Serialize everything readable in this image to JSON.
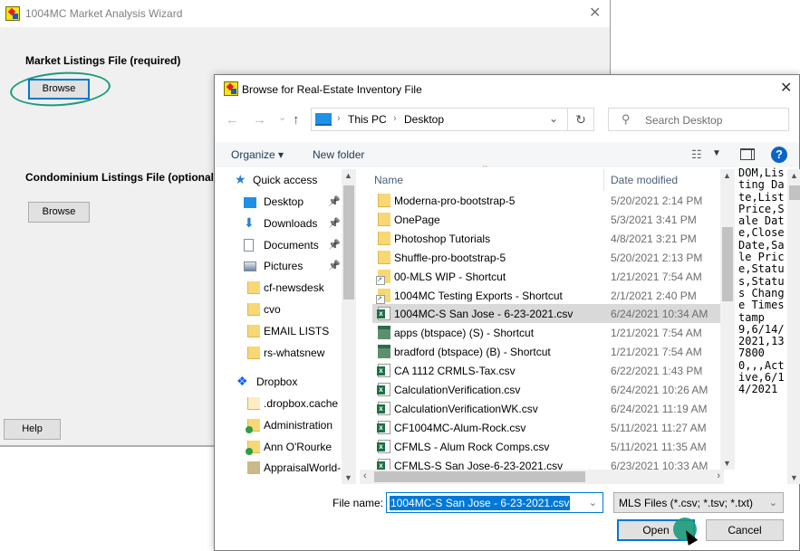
{
  "wizard": {
    "title": "1004MC Market Analysis Wizard",
    "market_label": "Market Listings File (required)",
    "market_browse": "Browse",
    "condo_label": "Condominium Listings File (optional)",
    "condo_browse": "Browse",
    "help": "Help",
    "close": "✕"
  },
  "dialog": {
    "title": "Browse for Real-Estate Inventory File",
    "close": "✕",
    "nav": {
      "back": "←",
      "forward": "→",
      "recent": "⌄",
      "up": "↑"
    },
    "breadcrumb": [
      "This PC",
      "Desktop"
    ],
    "breadcrumb_sep": "›",
    "refresh": "↻",
    "search_placeholder": "Search Desktop",
    "toolbar": {
      "organize": "Organize ▾",
      "new_folder": "New folder"
    },
    "nav_pane": [
      {
        "label": "Quick access",
        "icon": "star-icon"
      },
      {
        "label": "Desktop",
        "icon": "desktop-icon",
        "pinned": true
      },
      {
        "label": "Downloads",
        "icon": "download-icon",
        "pinned": true
      },
      {
        "label": "Documents",
        "icon": "document-icon",
        "pinned": true
      },
      {
        "label": "Pictures",
        "icon": "pictures-icon",
        "pinned": true
      },
      {
        "label": "cf-newsdesk",
        "icon": "folder-icon"
      },
      {
        "label": "cvo",
        "icon": "folder-icon"
      },
      {
        "label": "EMAIL LISTS",
        "icon": "folder-icon"
      },
      {
        "label": "rs-whatsnew",
        "icon": "folder-icon"
      },
      {
        "label": "Dropbox",
        "icon": "dropbox-icon"
      },
      {
        "label": ".dropbox.cache",
        "icon": "folder-icon"
      },
      {
        "label": "Administration",
        "icon": "folder-icon"
      },
      {
        "label": "Ann O'Rourke",
        "icon": "folder-icon"
      },
      {
        "label": "AppraisalWorld-",
        "icon": "shared-folder-icon"
      }
    ],
    "columns": {
      "name": "Name",
      "date": "Date modified"
    },
    "files": [
      {
        "name": "Moderna-pro-bootstrap-5",
        "date": "5/20/2021 2:14 PM",
        "type": "folder"
      },
      {
        "name": "OnePage",
        "date": "5/3/2021 3:41 PM",
        "type": "folder"
      },
      {
        "name": "Photoshop Tutorials",
        "date": "4/8/2021 3:21 PM",
        "type": "folder"
      },
      {
        "name": "Shuffle-pro-bootstrap-5",
        "date": "5/20/2021 2:13 PM",
        "type": "folder"
      },
      {
        "name": "00-MLS WIP - Shortcut",
        "date": "1/21/2021 7:54 AM",
        "type": "shortcut"
      },
      {
        "name": "1004MC Testing Exports - Shortcut",
        "date": "2/1/2021 2:40 PM",
        "type": "shortcut"
      },
      {
        "name": "1004MC-S San Jose - 6-23-2021.csv",
        "date": "6/24/2021 10:34 AM",
        "type": "csv",
        "selected": true
      },
      {
        "name": "apps (btspace) (S) - Shortcut",
        "date": "1/21/2021 7:54 AM",
        "type": "network"
      },
      {
        "name": "bradford (btspace) (B) - Shortcut",
        "date": "1/21/2021 7:54 AM",
        "type": "network"
      },
      {
        "name": "CA 1112 CRMLS-Tax.csv",
        "date": "6/22/2021 1:43 PM",
        "type": "csv"
      },
      {
        "name": "CalculationVerification.csv",
        "date": "6/24/2021 10:26 AM",
        "type": "csv"
      },
      {
        "name": "CalculationVerificationWK.csv",
        "date": "6/24/2021 11:19 AM",
        "type": "csv"
      },
      {
        "name": "CF1004MC-Alum-Rock.csv",
        "date": "5/11/2021 11:27 AM",
        "type": "csv"
      },
      {
        "name": "CFMLS - Alum Rock Comps.csv",
        "date": "5/11/2021 11:35 AM",
        "type": "csv"
      },
      {
        "name": "CFMLS-S San Jose-6-23-2021.csv",
        "date": "6/23/2021 10:33 AM",
        "type": "csv"
      }
    ],
    "preview_text": "DOM,Listing Date,List Price,Sale Date,Close Date,Sale Price,Status,Status Change Timestamp\n9,6/14/2021,1378000,,,Active,6/14/2021",
    "file_name_label": "File name:",
    "file_name_value": "1004MC-S San Jose - 6-23-2021.csv",
    "file_type": "MLS Files (*.csv; *.tsv; *.txt)",
    "open": "Open",
    "cancel": "Cancel"
  },
  "colors": {
    "accent": "#0078d7",
    "highlight_ring": "#1c9a7c",
    "selected_row": "#d9d9d9"
  }
}
